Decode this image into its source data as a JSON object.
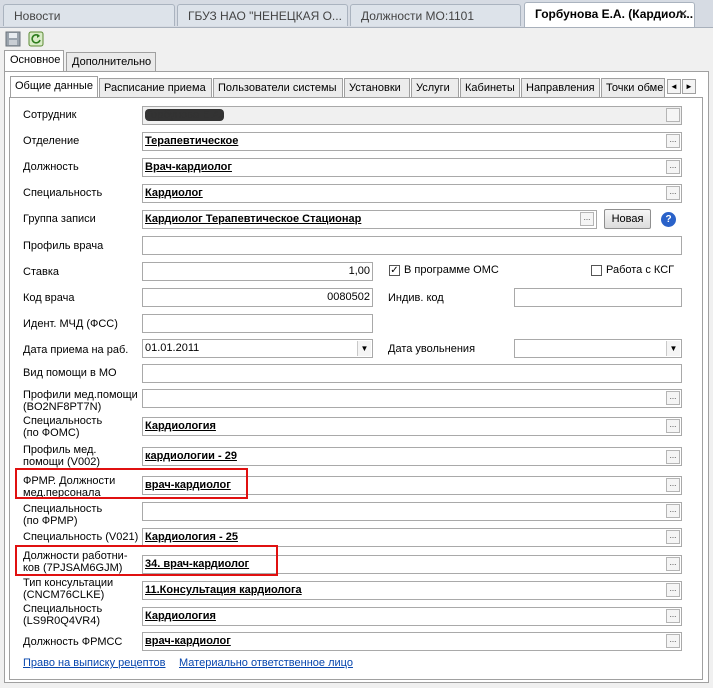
{
  "doc_tabs": [
    "Новости",
    "ГБУЗ НАО \"НЕНЕЦКАЯ О...",
    "Должности МО:1101",
    "Горбунова Е.А. (Кардиол..."
  ],
  "doc_tab_close": "✕",
  "outer_tabs": [
    "Основное",
    "Дополнительно"
  ],
  "inner_tabs": [
    "Общие данные",
    "Расписание приема",
    "Пользователи системы",
    "Установки",
    "Услуги",
    "Кабинеты",
    "Направления",
    "Точки обме"
  ],
  "colors": {
    "highlight_box": "#e01010",
    "link": "#0645ad",
    "help": "#2a62c9"
  },
  "form": {
    "sotrudnik": {
      "label": "Сотрудник",
      "value": "Горбунова Е.А."
    },
    "otdelenie": {
      "label": "Отделение",
      "value": "Терапевтическое"
    },
    "dolzhnost": {
      "label": "Должность",
      "value": "Врач-кардиолог"
    },
    "specialnost": {
      "label": "Специальность",
      "value": "Кардиолог"
    },
    "gruppa": {
      "label": "Группа записи",
      "value": "Кардиолог  Терапевтическое Стационар",
      "new_button": "Новая"
    },
    "profil": {
      "label": "Профиль врача",
      "value": ""
    },
    "stavka": {
      "label": "Ставка",
      "value": "1,00"
    },
    "v_oms": {
      "label": "В программе ОМС",
      "checked": true
    },
    "ksg": {
      "label": "Работа с КСГ",
      "checked": false
    },
    "kod_vracha": {
      "label": "Код врача",
      "value": "0080502"
    },
    "indiv_kod": {
      "label": "Индив. код",
      "value": ""
    },
    "ident": {
      "label": "Идент. МЧД (ФСС)",
      "value": ""
    },
    "data_priema": {
      "label": "Дата приема на раб.",
      "value": "01.01.2011"
    },
    "data_uvol": {
      "label": "Дата увольнения",
      "value": ""
    },
    "vid_pomoshi": {
      "label": "Вид помощи в МО",
      "value": ""
    },
    "profili_med": {
      "label1": "Профили мед.помощи",
      "label2": " (BO2NF8PT7N)",
      "value": ""
    },
    "spec_foms": {
      "label1": "Специальность",
      "label2": "(по ФОМС)",
      "value": "Кардиология"
    },
    "profil_v002": {
      "label1": "Профиль  мед.",
      "label2": "помощи (V002)",
      "value": "кардиологии - 29"
    },
    "frmr_dolzh": {
      "label1": "ФРМР. Должности",
      "label2": "мед.персонала",
      "value": "врач-кардиолог"
    },
    "spec_frmr": {
      "label1": "Специальность",
      "label2": "(по ФРМР)",
      "value": ""
    },
    "spec_v021": {
      "label": "Специальность (V021)",
      "value": "Кардиология - 25"
    },
    "dolzh_rab": {
      "label1": "Должности работни-",
      "label2": "ков (7PJSAM6GJM)",
      "value": "34. врач-кардиолог"
    },
    "tip_kons": {
      "label1": "Тип консультации",
      "label2": "(CNCM76CLKE)",
      "value": "11.Консультация кардиолога"
    },
    "spec_ls9": {
      "label1": "Специальность",
      "label2": "(LS9R0Q4VR4)",
      "value": "Кардиология"
    },
    "dolzh_frmss": {
      "label": "Должность ФРМСС",
      "value": "врач-кардиолог"
    }
  },
  "links": {
    "recepty": "Право на выписку рецептов",
    "mol": "Материально ответственное лицо"
  },
  "ellipsis": "...",
  "dropdown_arrow": "▼",
  "scroll_left": "◄",
  "scroll_right": "►",
  "help": "?"
}
